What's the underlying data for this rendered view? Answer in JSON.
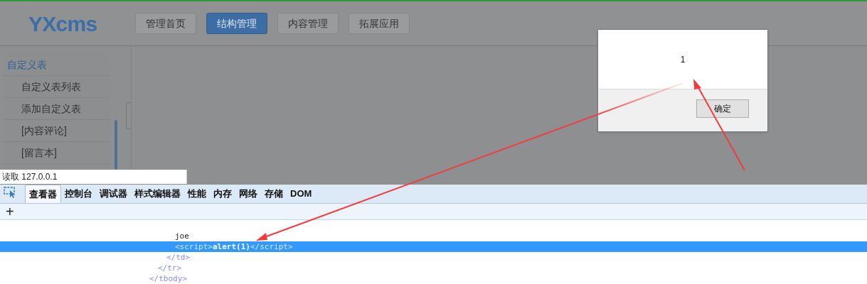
{
  "header": {
    "logo": "YXcms",
    "nav": [
      {
        "label": "管理首页",
        "selected": false
      },
      {
        "label": "结构管理",
        "selected": true
      },
      {
        "label": "内容管理",
        "selected": false
      },
      {
        "label": "拓展应用",
        "selected": false
      }
    ]
  },
  "sidebar": {
    "items": [
      {
        "kind": "heading",
        "label": "自定义表"
      },
      {
        "kind": "link",
        "label": "自定义表列表"
      },
      {
        "kind": "link",
        "label": "添加自定义表"
      },
      {
        "kind": "link",
        "label": "[内容评论]"
      },
      {
        "kind": "link",
        "label": "[留言本]"
      }
    ]
  },
  "status_bar": "读取 127.0.0.1",
  "alert": {
    "message": "1",
    "button": "确定"
  },
  "devtools": {
    "tabs": [
      {
        "label": "查看器",
        "selected": true
      },
      {
        "label": "控制台",
        "selected": false
      },
      {
        "label": "调试器",
        "selected": false
      },
      {
        "label": "样式编辑器",
        "selected": false
      },
      {
        "label": "性能",
        "selected": false
      },
      {
        "label": "内存",
        "selected": false
      },
      {
        "label": "网络",
        "selected": false
      },
      {
        "label": "存储",
        "selected": false
      },
      {
        "label": "DOM",
        "selected": false
      }
    ],
    "add_button": "+",
    "markup": [
      {
        "kind": "element",
        "closing": "</tbody>",
        "children": [
          {
            "kind": "element",
            "closing": "</tr>",
            "children": [
              {
                "kind": "element",
                "closing": "</td>",
                "children": [
                  {
                    "kind": "text",
                    "text": "joe",
                    "selected": false
                  },
                  {
                    "kind": "script",
                    "open_tag": "<script>",
                    "content": "alert(1)",
                    "close_tag": "</script>",
                    "selected": true
                  }
                ]
              }
            ]
          }
        ]
      }
    ]
  }
}
